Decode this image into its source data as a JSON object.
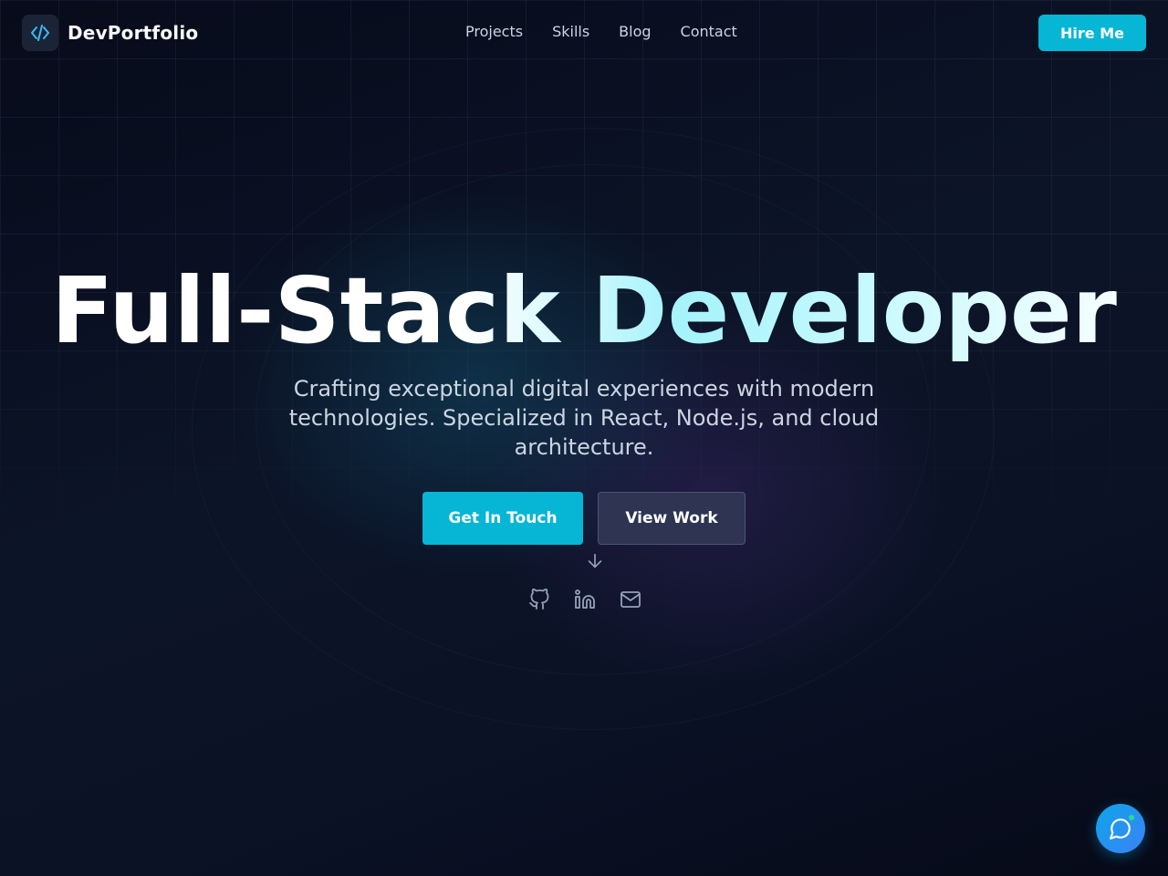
{
  "brand": {
    "name": "DevPortfolio",
    "icon": "code-icon"
  },
  "nav": {
    "items": [
      "Projects",
      "Skills",
      "Blog",
      "Contact"
    ]
  },
  "header": {
    "cta_label": "Hire Me"
  },
  "hero": {
    "title": "Full-Stack Developer",
    "subtitle": "Crafting exceptional digital experiences with modern technologies. Specialized in React, Node.js, and cloud architecture.",
    "primary_label": "Get In Touch",
    "secondary_label": "View Work",
    "scroll_icon": "arrow-down-icon"
  },
  "socials": [
    "github-icon",
    "linkedin-icon",
    "mail-icon"
  ],
  "chat": {
    "icon": "chat-icon"
  },
  "colors": {
    "accent": "#06b6d4",
    "background": "#0a1020",
    "secondary_button": "#2e3452"
  }
}
